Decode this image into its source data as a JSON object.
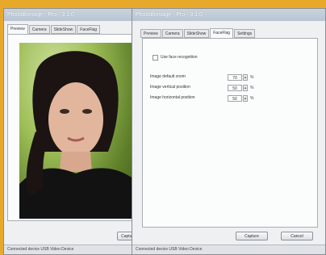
{
  "back_window": {
    "title": "PhotoBinnage - Pro - 3.1.0",
    "tabs": [
      "Preview",
      "Camera",
      "SlideShow",
      "FaceFlag"
    ],
    "button": "Capture",
    "status": "Connected device USB Video Device"
  },
  "front_window": {
    "title": "PhotoBinnage - Pro - 3.1.0",
    "tabs": [
      "Preview",
      "Camera",
      "SlideShow",
      "FaceFlag",
      "Settings"
    ],
    "checkbox_label": "Use face recognition",
    "fields": [
      {
        "label": "Image default zoom",
        "value": "70",
        "unit": "%"
      },
      {
        "label": "Image vertical position",
        "value": "50",
        "unit": "%"
      },
      {
        "label": "Image horizontal position",
        "value": "50",
        "unit": "%"
      }
    ],
    "buttons": {
      "capture": "Capture",
      "cancel": "Cancel"
    },
    "status": "Connected device USB Video Device"
  },
  "colors": {
    "background": "#e8a92a",
    "window": "#eef0f2"
  }
}
